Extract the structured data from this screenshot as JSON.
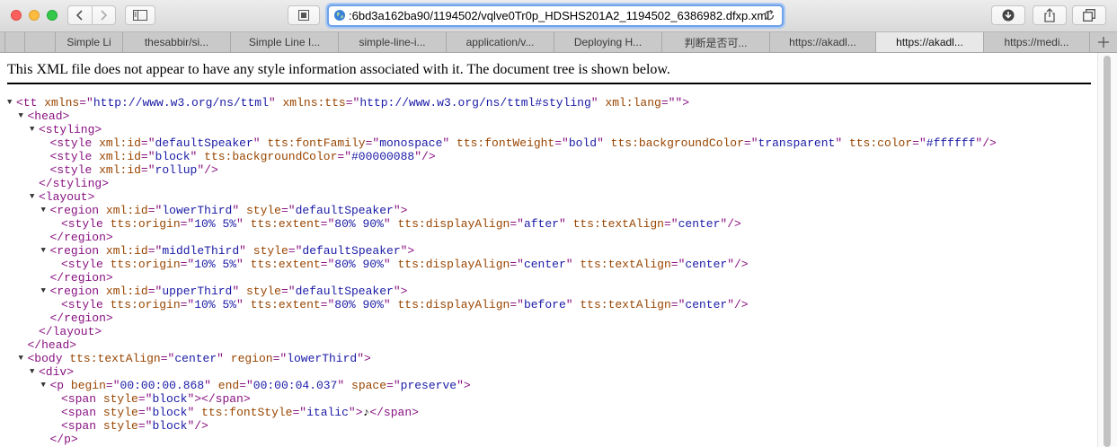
{
  "colors": {
    "tag": "#881280",
    "attr_name": "#994500",
    "attr_value": "#1a1aa6",
    "url_focus": "#6ea1e8"
  },
  "toolbar": {
    "back_icon": "chevron-left-icon",
    "forward_icon": "chevron-right-icon",
    "sidebar_icon": "sidebar-icon",
    "reader_icon": "reader-icon",
    "url": ":6bd3a162ba90/1194502/vqlve0Tr0p_HDSHS201A2_1194502_6386982.dfxp.xml",
    "download_icon": "download-icon",
    "share_icon": "share-icon",
    "tabs_icon": "tab-overview-icon"
  },
  "tabs": [
    {
      "label": "Simple Li"
    },
    {
      "label": "thesabbir/si..."
    },
    {
      "label": "Simple Line I..."
    },
    {
      "label": "simple-line-i..."
    },
    {
      "label": "application/v..."
    },
    {
      "label": "Deploying H..."
    },
    {
      "label": "判断是否可..."
    },
    {
      "label": "https://akadl..."
    },
    {
      "label": "https://akadl..."
    },
    {
      "label": "https://medi..."
    }
  ],
  "active_tab": 8,
  "notice": "This XML file does not appear to have any style information associated with it. The document tree is shown below.",
  "xml_lines": [
    {
      "indent": 0,
      "toggle": true,
      "parts": [
        {
          "t": "tg",
          "v": "<tt "
        },
        {
          "t": "an",
          "v": "xmlns"
        },
        {
          "t": "tg",
          "v": "=\""
        },
        {
          "t": "av",
          "v": "http://www.w3.org/ns/ttml"
        },
        {
          "t": "tg",
          "v": "\" "
        },
        {
          "t": "an",
          "v": "xmlns:tts"
        },
        {
          "t": "tg",
          "v": "=\""
        },
        {
          "t": "av",
          "v": "http://www.w3.org/ns/ttml#styling"
        },
        {
          "t": "tg",
          "v": "\" "
        },
        {
          "t": "an",
          "v": "xml:lang"
        },
        {
          "t": "tg",
          "v": "=\"\">"
        }
      ]
    },
    {
      "indent": 1,
      "toggle": true,
      "parts": [
        {
          "t": "tg",
          "v": "<head>"
        }
      ]
    },
    {
      "indent": 2,
      "toggle": true,
      "parts": [
        {
          "t": "tg",
          "v": "<styling>"
        }
      ]
    },
    {
      "indent": 3,
      "toggle": false,
      "parts": [
        {
          "t": "tg",
          "v": "<style "
        },
        {
          "t": "an",
          "v": "xml:id"
        },
        {
          "t": "tg",
          "v": "=\""
        },
        {
          "t": "av",
          "v": "defaultSpeaker"
        },
        {
          "t": "tg",
          "v": "\" "
        },
        {
          "t": "an",
          "v": "tts:fontFamily"
        },
        {
          "t": "tg",
          "v": "=\""
        },
        {
          "t": "av",
          "v": "monospace"
        },
        {
          "t": "tg",
          "v": "\" "
        },
        {
          "t": "an",
          "v": "tts:fontWeight"
        },
        {
          "t": "tg",
          "v": "=\""
        },
        {
          "t": "av",
          "v": "bold"
        },
        {
          "t": "tg",
          "v": "\" "
        },
        {
          "t": "an",
          "v": "tts:backgroundColor"
        },
        {
          "t": "tg",
          "v": "=\""
        },
        {
          "t": "av",
          "v": "transparent"
        },
        {
          "t": "tg",
          "v": "\" "
        },
        {
          "t": "an",
          "v": "tts:color"
        },
        {
          "t": "tg",
          "v": "=\""
        },
        {
          "t": "av",
          "v": "#ffffff"
        },
        {
          "t": "tg",
          "v": "\"/>"
        }
      ]
    },
    {
      "indent": 3,
      "toggle": false,
      "parts": [
        {
          "t": "tg",
          "v": "<style "
        },
        {
          "t": "an",
          "v": "xml:id"
        },
        {
          "t": "tg",
          "v": "=\""
        },
        {
          "t": "av",
          "v": "block"
        },
        {
          "t": "tg",
          "v": "\" "
        },
        {
          "t": "an",
          "v": "tts:backgroundColor"
        },
        {
          "t": "tg",
          "v": "=\""
        },
        {
          "t": "av",
          "v": "#00000088"
        },
        {
          "t": "tg",
          "v": "\"/>"
        }
      ]
    },
    {
      "indent": 3,
      "toggle": false,
      "parts": [
        {
          "t": "tg",
          "v": "<style "
        },
        {
          "t": "an",
          "v": "xml:id"
        },
        {
          "t": "tg",
          "v": "=\""
        },
        {
          "t": "av",
          "v": "rollup"
        },
        {
          "t": "tg",
          "v": "\"/>"
        }
      ]
    },
    {
      "indent": 2,
      "toggle": false,
      "parts": [
        {
          "t": "tg",
          "v": "</styling>"
        }
      ]
    },
    {
      "indent": 2,
      "toggle": true,
      "parts": [
        {
          "t": "tg",
          "v": "<layout>"
        }
      ]
    },
    {
      "indent": 3,
      "toggle": true,
      "parts": [
        {
          "t": "tg",
          "v": "<region "
        },
        {
          "t": "an",
          "v": "xml:id"
        },
        {
          "t": "tg",
          "v": "=\""
        },
        {
          "t": "av",
          "v": "lowerThird"
        },
        {
          "t": "tg",
          "v": "\" "
        },
        {
          "t": "an",
          "v": "style"
        },
        {
          "t": "tg",
          "v": "=\""
        },
        {
          "t": "av",
          "v": "defaultSpeaker"
        },
        {
          "t": "tg",
          "v": "\">"
        }
      ]
    },
    {
      "indent": 4,
      "toggle": false,
      "parts": [
        {
          "t": "tg",
          "v": "<style "
        },
        {
          "t": "an",
          "v": "tts:origin"
        },
        {
          "t": "tg",
          "v": "=\""
        },
        {
          "t": "av",
          "v": "10% 5%"
        },
        {
          "t": "tg",
          "v": "\" "
        },
        {
          "t": "an",
          "v": "tts:extent"
        },
        {
          "t": "tg",
          "v": "=\""
        },
        {
          "t": "av",
          "v": "80% 90%"
        },
        {
          "t": "tg",
          "v": "\" "
        },
        {
          "t": "an",
          "v": "tts:displayAlign"
        },
        {
          "t": "tg",
          "v": "=\""
        },
        {
          "t": "av",
          "v": "after"
        },
        {
          "t": "tg",
          "v": "\" "
        },
        {
          "t": "an",
          "v": "tts:textAlign"
        },
        {
          "t": "tg",
          "v": "=\""
        },
        {
          "t": "av",
          "v": "center"
        },
        {
          "t": "tg",
          "v": "\"/>"
        }
      ]
    },
    {
      "indent": 3,
      "toggle": false,
      "parts": [
        {
          "t": "tg",
          "v": "</region>"
        }
      ]
    },
    {
      "indent": 3,
      "toggle": true,
      "parts": [
        {
          "t": "tg",
          "v": "<region "
        },
        {
          "t": "an",
          "v": "xml:id"
        },
        {
          "t": "tg",
          "v": "=\""
        },
        {
          "t": "av",
          "v": "middleThird"
        },
        {
          "t": "tg",
          "v": "\" "
        },
        {
          "t": "an",
          "v": "style"
        },
        {
          "t": "tg",
          "v": "=\""
        },
        {
          "t": "av",
          "v": "defaultSpeaker"
        },
        {
          "t": "tg",
          "v": "\">"
        }
      ]
    },
    {
      "indent": 4,
      "toggle": false,
      "parts": [
        {
          "t": "tg",
          "v": "<style "
        },
        {
          "t": "an",
          "v": "tts:origin"
        },
        {
          "t": "tg",
          "v": "=\""
        },
        {
          "t": "av",
          "v": "10% 5%"
        },
        {
          "t": "tg",
          "v": "\" "
        },
        {
          "t": "an",
          "v": "tts:extent"
        },
        {
          "t": "tg",
          "v": "=\""
        },
        {
          "t": "av",
          "v": "80% 90%"
        },
        {
          "t": "tg",
          "v": "\" "
        },
        {
          "t": "an",
          "v": "tts:displayAlign"
        },
        {
          "t": "tg",
          "v": "=\""
        },
        {
          "t": "av",
          "v": "center"
        },
        {
          "t": "tg",
          "v": "\" "
        },
        {
          "t": "an",
          "v": "tts:textAlign"
        },
        {
          "t": "tg",
          "v": "=\""
        },
        {
          "t": "av",
          "v": "center"
        },
        {
          "t": "tg",
          "v": "\"/>"
        }
      ]
    },
    {
      "indent": 3,
      "toggle": false,
      "parts": [
        {
          "t": "tg",
          "v": "</region>"
        }
      ]
    },
    {
      "indent": 3,
      "toggle": true,
      "parts": [
        {
          "t": "tg",
          "v": "<region "
        },
        {
          "t": "an",
          "v": "xml:id"
        },
        {
          "t": "tg",
          "v": "=\""
        },
        {
          "t": "av",
          "v": "upperThird"
        },
        {
          "t": "tg",
          "v": "\" "
        },
        {
          "t": "an",
          "v": "style"
        },
        {
          "t": "tg",
          "v": "=\""
        },
        {
          "t": "av",
          "v": "defaultSpeaker"
        },
        {
          "t": "tg",
          "v": "\">"
        }
      ]
    },
    {
      "indent": 4,
      "toggle": false,
      "parts": [
        {
          "t": "tg",
          "v": "<style "
        },
        {
          "t": "an",
          "v": "tts:origin"
        },
        {
          "t": "tg",
          "v": "=\""
        },
        {
          "t": "av",
          "v": "10% 5%"
        },
        {
          "t": "tg",
          "v": "\" "
        },
        {
          "t": "an",
          "v": "tts:extent"
        },
        {
          "t": "tg",
          "v": "=\""
        },
        {
          "t": "av",
          "v": "80% 90%"
        },
        {
          "t": "tg",
          "v": "\" "
        },
        {
          "t": "an",
          "v": "tts:displayAlign"
        },
        {
          "t": "tg",
          "v": "=\""
        },
        {
          "t": "av",
          "v": "before"
        },
        {
          "t": "tg",
          "v": "\" "
        },
        {
          "t": "an",
          "v": "tts:textAlign"
        },
        {
          "t": "tg",
          "v": "=\""
        },
        {
          "t": "av",
          "v": "center"
        },
        {
          "t": "tg",
          "v": "\"/>"
        }
      ]
    },
    {
      "indent": 3,
      "toggle": false,
      "parts": [
        {
          "t": "tg",
          "v": "</region>"
        }
      ]
    },
    {
      "indent": 2,
      "toggle": false,
      "parts": [
        {
          "t": "tg",
          "v": "</layout>"
        }
      ]
    },
    {
      "indent": 1,
      "toggle": false,
      "parts": [
        {
          "t": "tg",
          "v": "</head>"
        }
      ]
    },
    {
      "indent": 1,
      "toggle": true,
      "parts": [
        {
          "t": "tg",
          "v": "<body "
        },
        {
          "t": "an",
          "v": "tts:textAlign"
        },
        {
          "t": "tg",
          "v": "=\""
        },
        {
          "t": "av",
          "v": "center"
        },
        {
          "t": "tg",
          "v": "\" "
        },
        {
          "t": "an",
          "v": "region"
        },
        {
          "t": "tg",
          "v": "=\""
        },
        {
          "t": "av",
          "v": "lowerThird"
        },
        {
          "t": "tg",
          "v": "\">"
        }
      ]
    },
    {
      "indent": 2,
      "toggle": true,
      "parts": [
        {
          "t": "tg",
          "v": "<div>"
        }
      ]
    },
    {
      "indent": 3,
      "toggle": true,
      "parts": [
        {
          "t": "tg",
          "v": "<p "
        },
        {
          "t": "an",
          "v": "begin"
        },
        {
          "t": "tg",
          "v": "=\""
        },
        {
          "t": "av",
          "v": "00:00:00.868"
        },
        {
          "t": "tg",
          "v": "\" "
        },
        {
          "t": "an",
          "v": "end"
        },
        {
          "t": "tg",
          "v": "=\""
        },
        {
          "t": "av",
          "v": "00:00:04.037"
        },
        {
          "t": "tg",
          "v": "\" "
        },
        {
          "t": "an",
          "v": "space"
        },
        {
          "t": "tg",
          "v": "=\""
        },
        {
          "t": "av",
          "v": "preserve"
        },
        {
          "t": "tg",
          "v": "\">"
        }
      ]
    },
    {
      "indent": 4,
      "toggle": false,
      "parts": [
        {
          "t": "tg",
          "v": "<span "
        },
        {
          "t": "an",
          "v": "style"
        },
        {
          "t": "tg",
          "v": "=\""
        },
        {
          "t": "av",
          "v": "block"
        },
        {
          "t": "tg",
          "v": "\"></span>"
        }
      ]
    },
    {
      "indent": 4,
      "toggle": false,
      "parts": [
        {
          "t": "tg",
          "v": "<span "
        },
        {
          "t": "an",
          "v": "style"
        },
        {
          "t": "tg",
          "v": "=\""
        },
        {
          "t": "av",
          "v": "block"
        },
        {
          "t": "tg",
          "v": "\" "
        },
        {
          "t": "an",
          "v": "tts:fontStyle"
        },
        {
          "t": "tg",
          "v": "=\""
        },
        {
          "t": "av",
          "v": "italic"
        },
        {
          "t": "tg",
          "v": "\">"
        },
        {
          "t": "tx",
          "v": "♪"
        },
        {
          "t": "tg",
          "v": "</span>"
        }
      ]
    },
    {
      "indent": 4,
      "toggle": false,
      "parts": [
        {
          "t": "tg",
          "v": "<span "
        },
        {
          "t": "an",
          "v": "style"
        },
        {
          "t": "tg",
          "v": "=\""
        },
        {
          "t": "av",
          "v": "block"
        },
        {
          "t": "tg",
          "v": "\"/>"
        }
      ]
    },
    {
      "indent": 3,
      "toggle": false,
      "parts": [
        {
          "t": "tg",
          "v": "</p>"
        }
      ]
    }
  ]
}
